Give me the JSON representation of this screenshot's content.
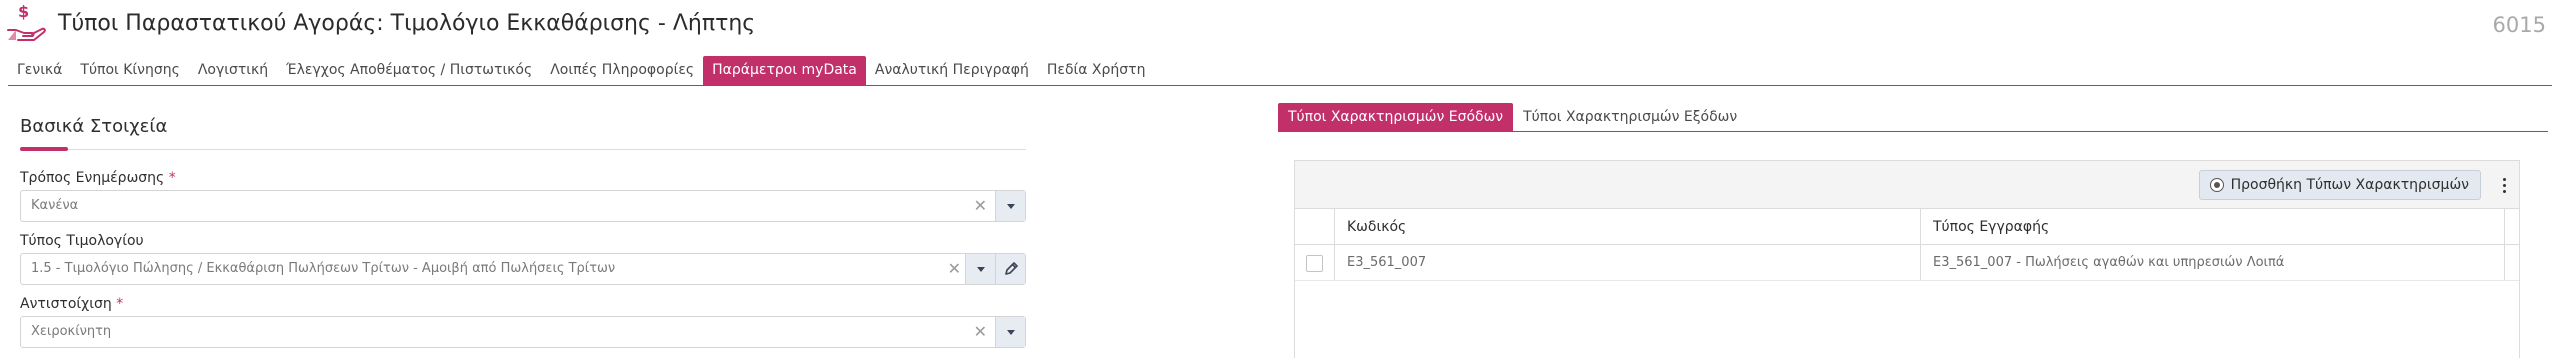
{
  "header": {
    "title": "Τύποι Παραστατικού Αγοράς: Τιμολόγιο Εκκαθάρισης - Λήπτης",
    "record_id": "6015",
    "icon": "hand-dollar-icon",
    "icon_color": "#c2306a"
  },
  "tabs": [
    {
      "label": "Γενικά",
      "active": false
    },
    {
      "label": "Τύποι Κίνησης",
      "active": false
    },
    {
      "label": "Λογιστική",
      "active": false
    },
    {
      "label": "Έλεγχος Αποθέματος / Πιστωτικός",
      "active": false
    },
    {
      "label": "Λοιπές Πληροφορίες",
      "active": false
    },
    {
      "label": "Παράμετροι myData",
      "active": true
    },
    {
      "label": "Αναλυτική Περιγραφή",
      "active": false
    },
    {
      "label": "Πεδία Χρήστη",
      "active": false
    }
  ],
  "basic": {
    "section_title": "Βασικά Στοιχεία",
    "update_mode": {
      "label": "Τρόπος Ενημέρωσης",
      "required": "*",
      "value": "Κανένα"
    },
    "invoice_type": {
      "label": "Τύπος Τιμολογίου",
      "value": "1.5 - Τιμολόγιο Πώλησης / Εκκαθάριση Πωλήσεων Τρίτων - Αμοιβή από Πωλήσεις Τρίτων"
    },
    "mapping": {
      "label": "Αντιστοίχιση",
      "required": "*",
      "value": "Χειροκίνητη"
    }
  },
  "classification_tabs": [
    {
      "label": "Τύποι Χαρακτηρισμών Εσόδων",
      "active": true
    },
    {
      "label": "Τύποι Χαρακτηρισμών Εξόδων",
      "active": false
    }
  ],
  "grid": {
    "add_button_label": "Προσθήκη Τύπων Χαρακτηρισμών",
    "columns": {
      "code": "Κωδικός",
      "type": "Τύπος Εγγραφής"
    },
    "rows": [
      {
        "code": "E3_561_007",
        "type": "E3_561_007 - Πωλήσεις αγαθών και υπηρεσιών Λοιπά"
      }
    ]
  },
  "colors": {
    "accent": "#c2306a",
    "button_bg": "#e4e8f0"
  }
}
